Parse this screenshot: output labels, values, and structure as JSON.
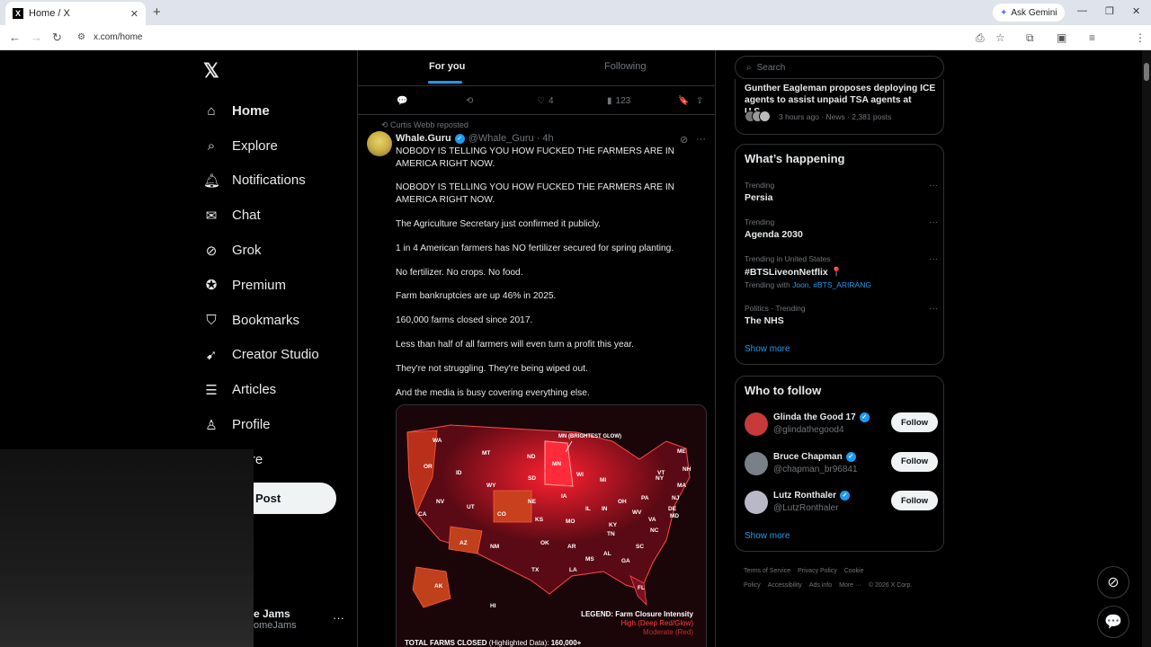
{
  "browser": {
    "tab_title": "Home / X",
    "url": "x.com/home",
    "gemini_label": "Ask Gemini"
  },
  "sidebar": {
    "items": [
      {
        "label": "Home",
        "icon": "home-icon"
      },
      {
        "label": "Explore",
        "icon": "search-icon"
      },
      {
        "label": "Notifications",
        "icon": "bell-icon"
      },
      {
        "label": "Chat",
        "icon": "mail-icon"
      },
      {
        "label": "Grok",
        "icon": "grok-icon"
      },
      {
        "label": "Premium",
        "icon": "premium-icon"
      },
      {
        "label": "Bookmarks",
        "icon": "bookmark-icon"
      },
      {
        "label": "Creator Studio",
        "icon": "rocket-icon"
      },
      {
        "label": "Articles",
        "icon": "articles-icon"
      },
      {
        "label": "Profile",
        "icon": "person-icon"
      },
      {
        "label": "More",
        "icon": "more-icon"
      }
    ],
    "post_label": "Post",
    "account_name": "e Jams",
    "account_handle": "omeJams"
  },
  "feed": {
    "tab_for_you": "For you",
    "tab_following": "Following",
    "prev_actions": {
      "likes": "4",
      "views": "123"
    },
    "repost_by": "Curtis Webb reposted",
    "author_name": "Whale.Guru",
    "author_meta": "@Whale_Guru · 4h",
    "paragraphs": [
      "NOBODY IS TELLING YOU HOW FUCKED THE FARMERS ARE IN AMERICA RIGHT NOW.",
      "NOBODY IS TELLING YOU HOW FUCKED THE FARMERS ARE IN AMERICA RIGHT NOW.",
      "The Agriculture Secretary just confirmed it publicly.",
      "1 in 4 American farmers has NO fertilizer secured for spring planting.",
      "No fertilizer. No crops. No food.",
      "Farm bankruptcies are up 46% in 2025.",
      "160,000 farms closed since 2017.",
      "Less than half of all farmers will even turn a profit this year.",
      "They're not struggling. They're being wiped out.",
      "And the media is busy covering everything else."
    ],
    "map": {
      "callout": "MN (BRIGHTEST GLOW)",
      "legend_title": "LEGEND: Farm Closure Intensity",
      "legend_high": "High (Deep Red/Glow)",
      "legend_moderate": "Moderate (Red)",
      "total_label": "TOTAL FARMS CLOSED",
      "total_sub": "(Highlighted Data):",
      "total_value": "160,000+",
      "states": [
        "WA",
        "MT",
        "ND",
        "MN",
        "OR",
        "ID",
        "SD",
        "WI",
        "MI",
        "ME",
        "VT",
        "NH",
        "NY",
        "MA",
        "WY",
        "IA",
        "NV",
        "UT",
        "CO",
        "NE",
        "IL",
        "IN",
        "OH",
        "PA",
        "NJ",
        "DE",
        "MD",
        "CA",
        "KS",
        "MO",
        "KY",
        "WV",
        "VA",
        "AZ",
        "NM",
        "OK",
        "AR",
        "TN",
        "NC",
        "SC",
        "TX",
        "LA",
        "MS",
        "AL",
        "GA",
        "AK",
        "HI",
        "FL"
      ]
    }
  },
  "right": {
    "search_placeholder": "Search",
    "news_headline": "Gunther Eagleman proposes deploying ICE agents to assist unpaid TSA agents at U.S....",
    "news_meta": "3 hours ago · News · 2,381 posts",
    "whats_happening_title": "What’s happening",
    "trends": [
      {
        "context": "Trending",
        "name": "Persia",
        "with": ""
      },
      {
        "context": "Trending",
        "name": "Agenda 2030",
        "with": ""
      },
      {
        "context": "Trending in United States",
        "name": "#BTSLiveonNetflix 📍",
        "with_prefix": "Trending with",
        "with": "Joon, #BTS_ARIRANG"
      },
      {
        "context": "Politics · Trending",
        "name": "The NHS",
        "with": ""
      }
    ],
    "show_more": "Show more",
    "who_to_follow_title": "Who to follow",
    "follow_label": "Follow",
    "suggestions": [
      {
        "name": "Glinda the Good 17",
        "handle": "@glindathegood4",
        "color": "#c63a3a"
      },
      {
        "name": "Bruce Chapman",
        "handle": "@chapman_br96841",
        "color": "#7a8088"
      },
      {
        "name": "Lutz Ronthaler",
        "handle": "@LutzRonthaler",
        "color": "#b8b8c8"
      }
    ],
    "footer": [
      "Terms of Service",
      "Privacy Policy",
      "Cookie Policy",
      "Accessibility",
      "Ads info",
      "More ···",
      "© 2026 X Corp."
    ]
  },
  "colors": {
    "accent": "#1d9bf0",
    "background": "#000000",
    "border": "#2f3336"
  }
}
